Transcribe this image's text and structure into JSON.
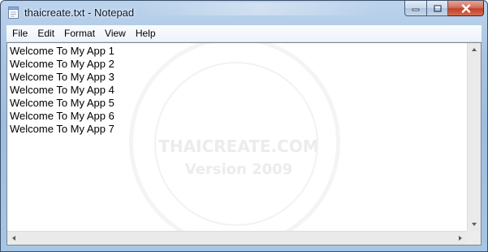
{
  "window": {
    "title": "thaicreate.txt - Notepad",
    "icon": "notepad-icon"
  },
  "caption_buttons": {
    "minimize_icon": "minimize-icon",
    "maximize_icon": "maximize-icon",
    "close_icon": "close-icon"
  },
  "menu": [
    "File",
    "Edit",
    "Format",
    "View",
    "Help"
  ],
  "editor": {
    "lines": [
      "Welcome To My App 1",
      "Welcome To My App 2",
      "Welcome To My App 3",
      "Welcome To My App 4",
      "Welcome To My App 5",
      "Welcome To My App 6",
      "Welcome To My App 7"
    ]
  },
  "watermark": {
    "line1": "THAICREATE.COM",
    "line2": "Version 2009"
  },
  "colors": {
    "titlebar": "#a9c4e3",
    "close_button": "#c0432b",
    "text": "#000000"
  }
}
